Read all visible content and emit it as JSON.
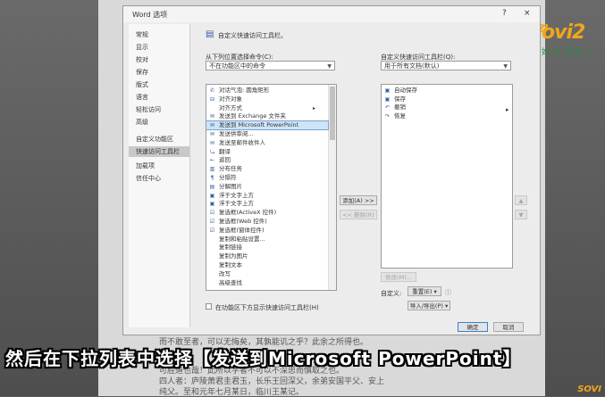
{
  "dialog": {
    "title": "Word 选项",
    "help_button": "?",
    "close_button": "×"
  },
  "nav": {
    "items": [
      "常规",
      "显示",
      "校对",
      "保存",
      "版式",
      "语言",
      "轻松访问",
      "高级",
      "自定义功能区",
      "快速访问工具栏",
      "加载项",
      "信任中心"
    ],
    "selected_index": 9
  },
  "content": {
    "header": "自定义快速访问工具栏。",
    "choose_label": "从下列位置选择命令(C):",
    "choose_value": "不在功能区中的命令",
    "customize_label": "自定义快速访问工具栏(Q):",
    "customize_value": "用于所有文档(默认)",
    "commands": [
      {
        "icon": "✆",
        "label": "对话气泡: 圆角矩形",
        "submenu": false
      },
      {
        "icon": "⊟",
        "label": "对齐对象",
        "submenu": false
      },
      {
        "icon": "",
        "label": "对齐方式",
        "submenu": true
      },
      {
        "icon": "✉",
        "label": "发送到 Exchange 文件夹",
        "submenu": false
      },
      {
        "icon": "✉",
        "label": "发送到 Microsoft PowerPoint",
        "submenu": false
      },
      {
        "icon": "✉",
        "label": "发送供审阅...",
        "submenu": false
      },
      {
        "icon": "✉",
        "label": "发送至邮件收件人",
        "submenu": false
      },
      {
        "icon": "⤿",
        "label": "翻译",
        "submenu": false
      },
      {
        "icon": "←",
        "label": "返回",
        "submenu": false
      },
      {
        "icon": "▥",
        "label": "分布任务",
        "submenu": false
      },
      {
        "icon": "¶",
        "label": "分隔符",
        "submenu": false
      },
      {
        "icon": "▤",
        "label": "分解图片",
        "submenu": false
      },
      {
        "icon": "▣",
        "label": "浮于文字上方",
        "submenu": false
      },
      {
        "icon": "▣",
        "label": "浮于文字上方",
        "submenu": false
      },
      {
        "icon": "☑",
        "label": "复选框(ActiveX 控件)",
        "submenu": false
      },
      {
        "icon": "☑",
        "label": "复选框(Web 控件)",
        "submenu": false
      },
      {
        "icon": "☑",
        "label": "复选框(窗体控件)",
        "submenu": false
      },
      {
        "icon": "",
        "label": "复制和粘贴设置...",
        "submenu": false
      },
      {
        "icon": "",
        "label": "复制链接",
        "submenu": false
      },
      {
        "icon": "",
        "label": "复制为图片",
        "submenu": false
      },
      {
        "icon": "",
        "label": "复制文本",
        "submenu": false
      },
      {
        "icon": "",
        "label": "改写",
        "submenu": false
      },
      {
        "icon": "",
        "label": "高级查找",
        "submenu": false
      }
    ],
    "selected_command_index": 4,
    "toolbar_items": [
      {
        "icon": "▣",
        "label": "自动保存"
      },
      {
        "icon": "▣",
        "label": "保存"
      },
      {
        "icon": "↶",
        "label": "撤销"
      },
      {
        "icon": "↷",
        "label": "恢复"
      }
    ],
    "add_button": "添加(A) >>",
    "remove_button": "<< 删除(R)",
    "modify_button": "修改(M)...",
    "customize_label2": "自定义:",
    "reset_button": "重置(E) ▾",
    "import_export_button": "导入/导出(P) ▾",
    "show_below_ribbon": "在功能区下方显示快速访问工具栏(H)",
    "ok_button": "确定",
    "cancel_button": "取消"
  },
  "caption": "然后在下拉列表中选择【发送到Microsoft PowerPoint】",
  "logo": {
    "word": "𝓢ovi2",
    "sub": "好生活好二",
    "corner": "SOVI"
  },
  "doc_lines": [
    "而不敢至者，可以无悔矣，其孰能讥之乎？此余之所得也。",
    "可胜道也哉！此所以学者不可以不深思而慎取之也。",
    "四人者：庐陵萧君圭君玉，长乐王回深父，余弟安国平父、安上",
    "纯父。至和元年七月某日，临川王某记。"
  ],
  "colors": {
    "selection": "#cce4f7",
    "accent": "#3a7fd0",
    "logo": "#f2a51a"
  }
}
